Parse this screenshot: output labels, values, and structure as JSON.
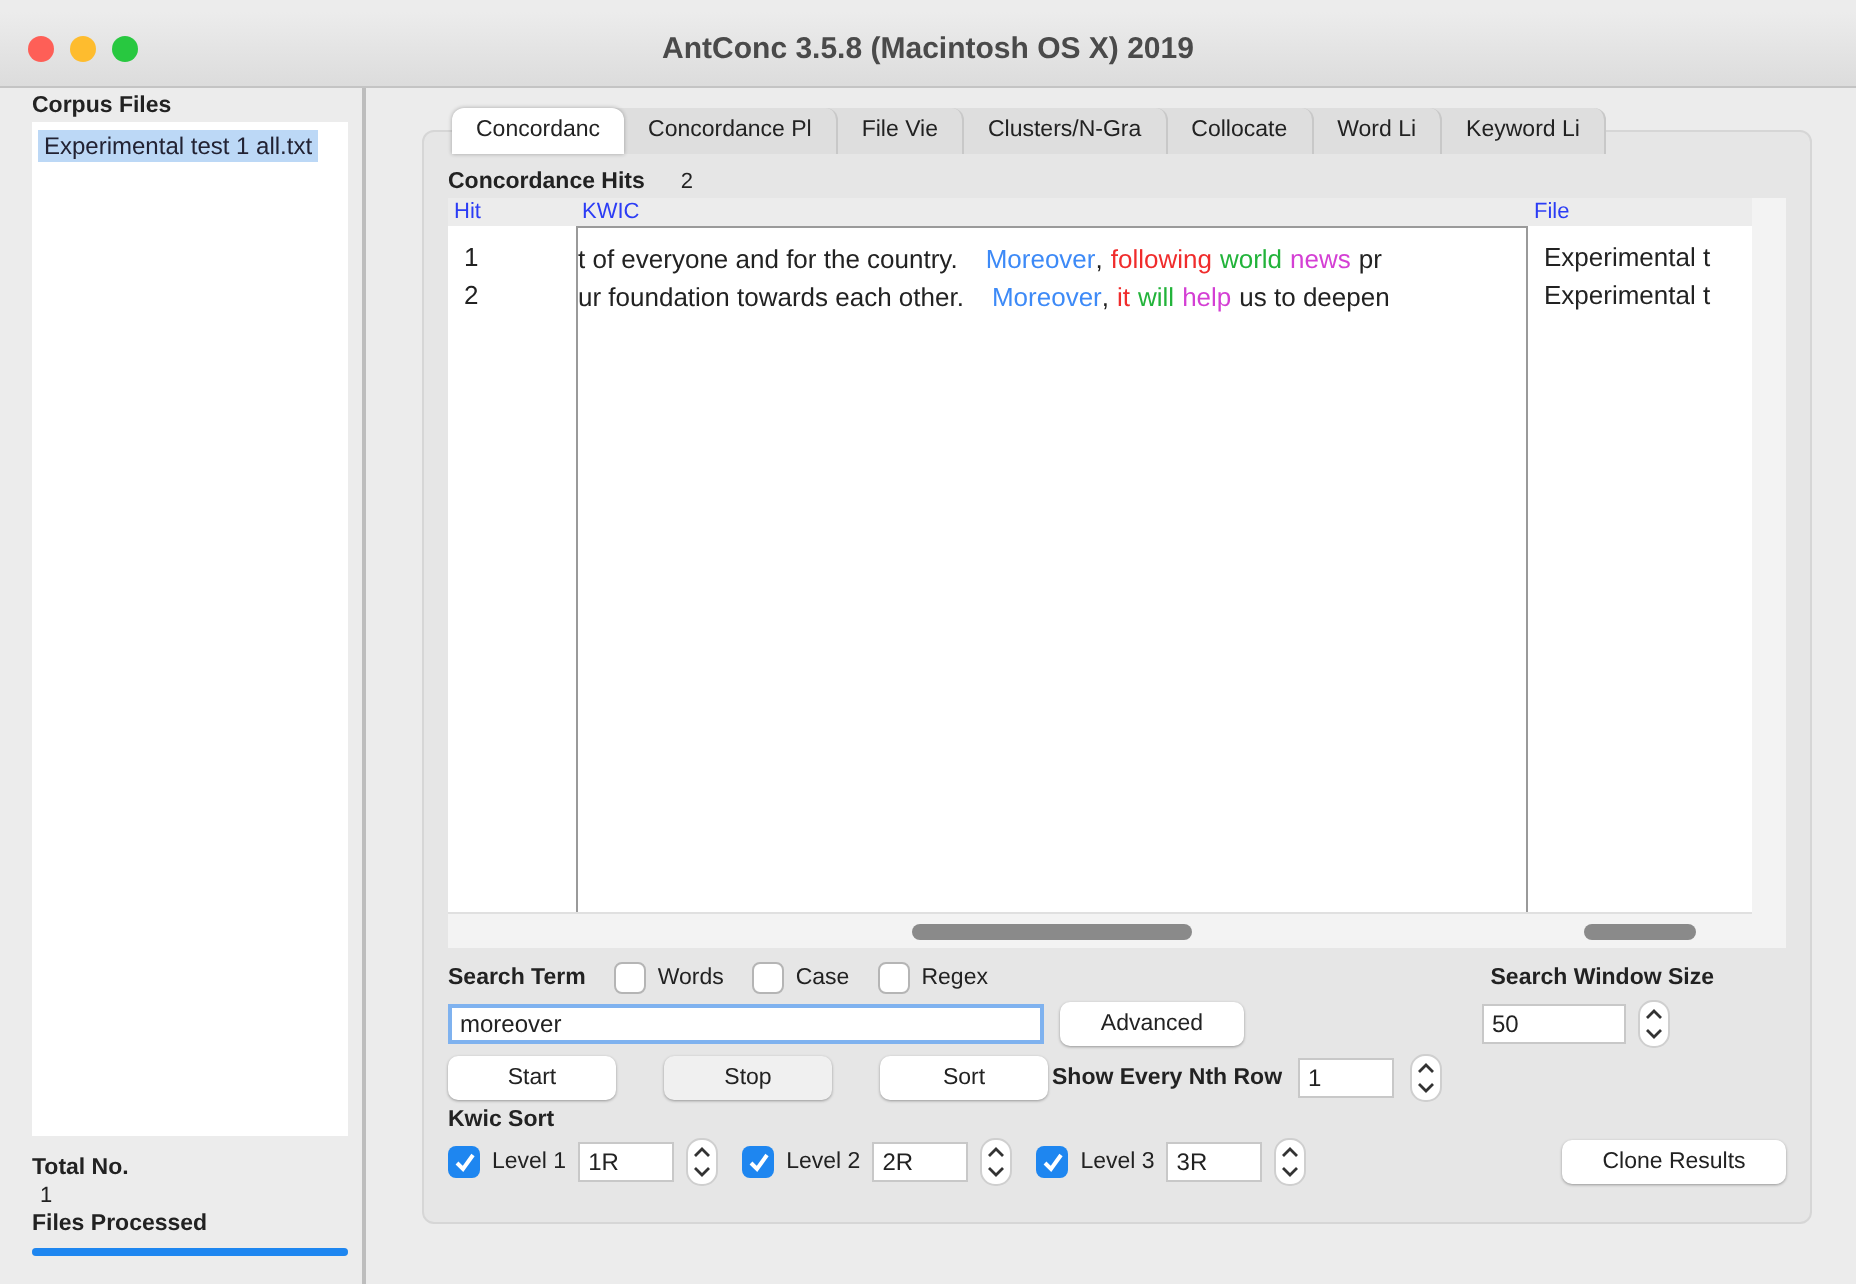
{
  "window": {
    "title": "AntConc 3.5.8 (Macintosh OS X) 2019"
  },
  "corpus_files": {
    "heading": "Corpus Files",
    "items": [
      {
        "label": "Experimental test 1 all.txt",
        "selected": true
      }
    ]
  },
  "totals": {
    "heading": "Total No.",
    "count": "1",
    "files_label": "Files Processed",
    "level": 1
  },
  "tabs": [
    {
      "label": "Concordanc",
      "selected": true
    },
    {
      "label": "Concordance Pl",
      "selected": false
    },
    {
      "label": "File Vie",
      "selected": false
    },
    {
      "label": "Clusters/N-Gra",
      "selected": false
    },
    {
      "label": "Collocate",
      "selected": false
    },
    {
      "label": "Word Li",
      "selected": false
    },
    {
      "label": "Keyword Li",
      "selected": false
    }
  ],
  "hits": {
    "label": "Concordance Hits",
    "count": "2"
  },
  "table": {
    "columns": [
      "Hit",
      "KWIC",
      "File"
    ],
    "rows": [
      {
        "hit": "1",
        "context": "t of everyone and for the country.",
        "kwic": [
          {
            "text": "Moreover",
            "color": "#3d8af7"
          },
          {
            "text": ",",
            "color": "#222222"
          },
          {
            "text": "following",
            "color": "#f02c2c"
          },
          {
            "text": "world",
            "color": "#22b33a"
          },
          {
            "text": "news",
            "color": "#d43fd4"
          },
          {
            "text": "pr",
            "color": "#222222"
          }
        ],
        "file": "Experimental t"
      },
      {
        "hit": "2",
        "context": "ur foundation towards each other.",
        "kwic": [
          {
            "text": "Moreover",
            "color": "#3d8af7"
          },
          {
            "text": ",",
            "color": "#222222"
          },
          {
            "text": "it",
            "color": "#f02c2c"
          },
          {
            "text": "will",
            "color": "#22b33a"
          },
          {
            "text": "help",
            "color": "#d43fd4"
          },
          {
            "text": "us to deepen",
            "color": "#222222"
          }
        ],
        "file": "Experimental t"
      }
    ]
  },
  "search": {
    "label": "Search Term",
    "options": [
      {
        "label": "Words",
        "checked": false
      },
      {
        "label": "Case",
        "checked": false
      },
      {
        "label": "Regex",
        "checked": false
      }
    ],
    "value": "moreover",
    "advanced": "Advanced"
  },
  "buttons": [
    {
      "label": "Start",
      "disabled": false
    },
    {
      "label": "Stop",
      "disabled": true
    },
    {
      "label": "Sort",
      "disabled": false
    }
  ],
  "nth_row": {
    "label": "Show Every Nth Row",
    "value": "1"
  },
  "window_size": {
    "label": "Search Window Size",
    "value": "50"
  },
  "kwic_sort": {
    "label": "Kwic Sort",
    "levels": [
      {
        "label": "Level 1",
        "checked": true,
        "value": "1R"
      },
      {
        "label": "Level 2",
        "checked": true,
        "value": "2R"
      },
      {
        "label": "Level 3",
        "checked": true,
        "value": "3R"
      }
    ]
  },
  "clone_button": "Clone Results"
}
